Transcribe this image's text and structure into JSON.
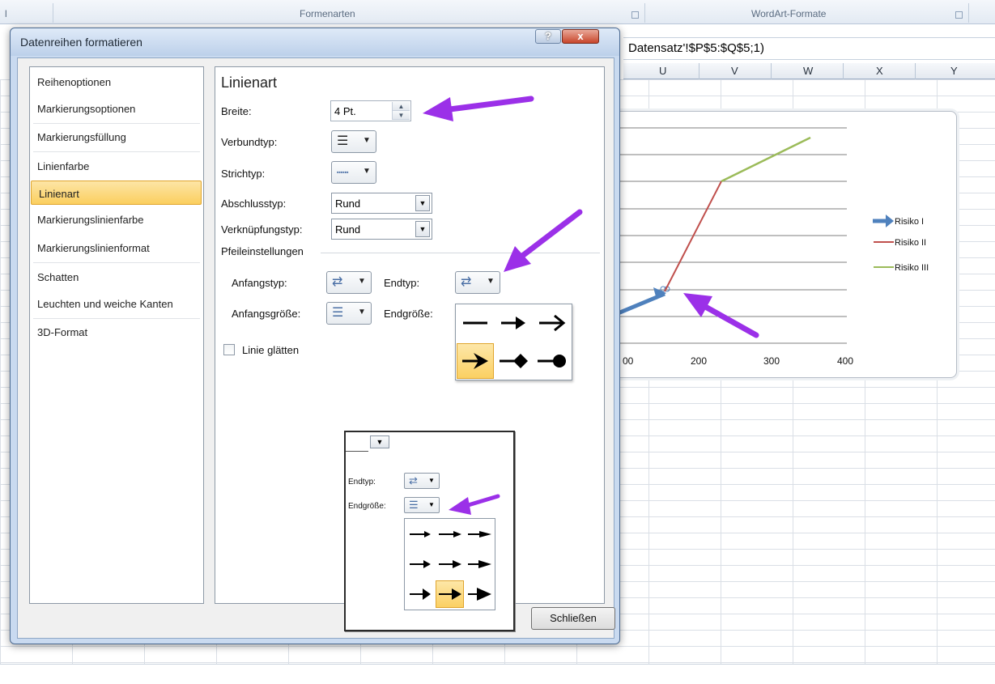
{
  "ribbon": {
    "group_shapes": "Formenarten",
    "group_wordart": "WordArt-Formate",
    "left_fragment": "l"
  },
  "formula_bar": {
    "text": "Datensatz'!$P$5:$Q$5;1)"
  },
  "columns": [
    "U",
    "V",
    "W",
    "X",
    "Y"
  ],
  "chart": {
    "chart_data": {
      "type": "line",
      "x_ticks": [
        "00",
        "200",
        "300",
        "400"
      ],
      "xlim": [
        100,
        400
      ],
      "grid": true,
      "legend_position": "right",
      "series": [
        {
          "name": "Risiko I",
          "color": "#4f81bd",
          "marker": "arrow-end"
        },
        {
          "name": "Risiko II",
          "color": "#c0504d"
        },
        {
          "name": "Risiko III",
          "color": "#9bbb59"
        }
      ]
    }
  },
  "dialog": {
    "title": "Datenreihen formatieren",
    "help": "?",
    "close": "x",
    "nav": [
      "Reihenoptionen",
      "Markierungsoptionen",
      "Markierungsfüllung",
      "Linienfarbe",
      "Linienart",
      "Markierungslinienfarbe",
      "Markierungslinienformat",
      "Schatten",
      "Leuchten und weiche Kanten",
      "3D-Format"
    ],
    "active_nav": "Linienart",
    "panel": {
      "title": "Linienart",
      "width_label": "Breite:",
      "width_value": "4 Pt.",
      "compound_label": "Verbundtyp:",
      "dash_label": "Strichtyp:",
      "cap_label": "Abschlusstyp:",
      "cap_value": "Rund",
      "join_label": "Verknüpfungstyp:",
      "join_value": "Rund",
      "arrow_section": "Pfeileinstellungen",
      "begin_type_label": "Anfangstyp:",
      "end_type_label": "Endtyp:",
      "begin_size_label": "Anfangsgröße:",
      "end_size_label": "Endgröße:",
      "smooth_label": "Linie glätten",
      "smooth_checked": false
    },
    "close_button": "Schließen"
  },
  "inset": {
    "end_type_label": "Endtyp:",
    "end_size_label": "Endgröße:"
  },
  "colors": {
    "annotation_arrow": "#9b30e8",
    "selection": "#fbd063",
    "dialog_frame": "#c9daf0"
  }
}
